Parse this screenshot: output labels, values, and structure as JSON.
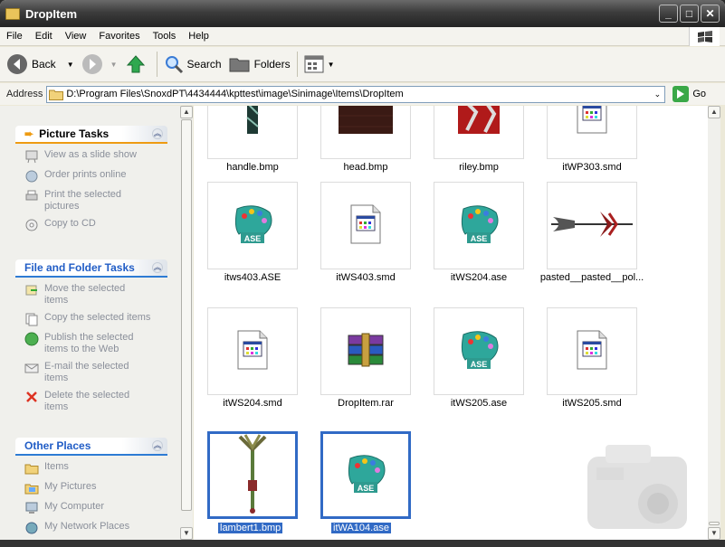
{
  "window": {
    "title": "DropItem",
    "minimize": "_",
    "maximize": "□",
    "close": "✕"
  },
  "menu": [
    "File",
    "Edit",
    "View",
    "Favorites",
    "Tools",
    "Help"
  ],
  "toolbar": {
    "back": "Back",
    "search": "Search",
    "folders": "Folders"
  },
  "address": {
    "label": "Address",
    "path": "D:\\Program Files\\SnoxdPT\\4434444\\kpttest\\image\\Sinimage\\Items\\DropItem",
    "go": "Go"
  },
  "panels": {
    "picture_tasks": {
      "title": "Picture Tasks",
      "items": [
        "View as a slide show",
        "Order prints online",
        "Print the selected pictures",
        "Copy to CD"
      ]
    },
    "file_tasks": {
      "title": "File and Folder Tasks",
      "items": [
        "Move the selected items",
        "Copy the selected items",
        "Publish the selected items to the Web",
        "E-mail the selected items",
        "Delete the selected items"
      ]
    },
    "other_places": {
      "title": "Other Places",
      "items": [
        "Items",
        "My Pictures",
        "My Computer",
        "My Network Places"
      ]
    }
  },
  "files": [
    {
      "name": "handle.bmp",
      "kind": "bmp-handle"
    },
    {
      "name": "head.bmp",
      "kind": "bmp-head"
    },
    {
      "name": "riley.bmp",
      "kind": "bmp-riley"
    },
    {
      "name": "itWP303.smd",
      "kind": "smd"
    },
    {
      "name": "itws403.ASE",
      "kind": "ase"
    },
    {
      "name": "itWS403.smd",
      "kind": "smd"
    },
    {
      "name": "itWS204.ase",
      "kind": "ase"
    },
    {
      "name": "pasted__pasted__pol...",
      "kind": "bmp-axe"
    },
    {
      "name": "itWS204.smd",
      "kind": "smd"
    },
    {
      "name": "DropItem.rar",
      "kind": "rar"
    },
    {
      "name": "itWS205.ase",
      "kind": "ase"
    },
    {
      "name": "itWS205.smd",
      "kind": "smd"
    },
    {
      "name": "lambert1.bmp",
      "kind": "bmp-staff",
      "selected": true
    },
    {
      "name": "itWA104.ase",
      "kind": "ase",
      "selected": true
    }
  ]
}
